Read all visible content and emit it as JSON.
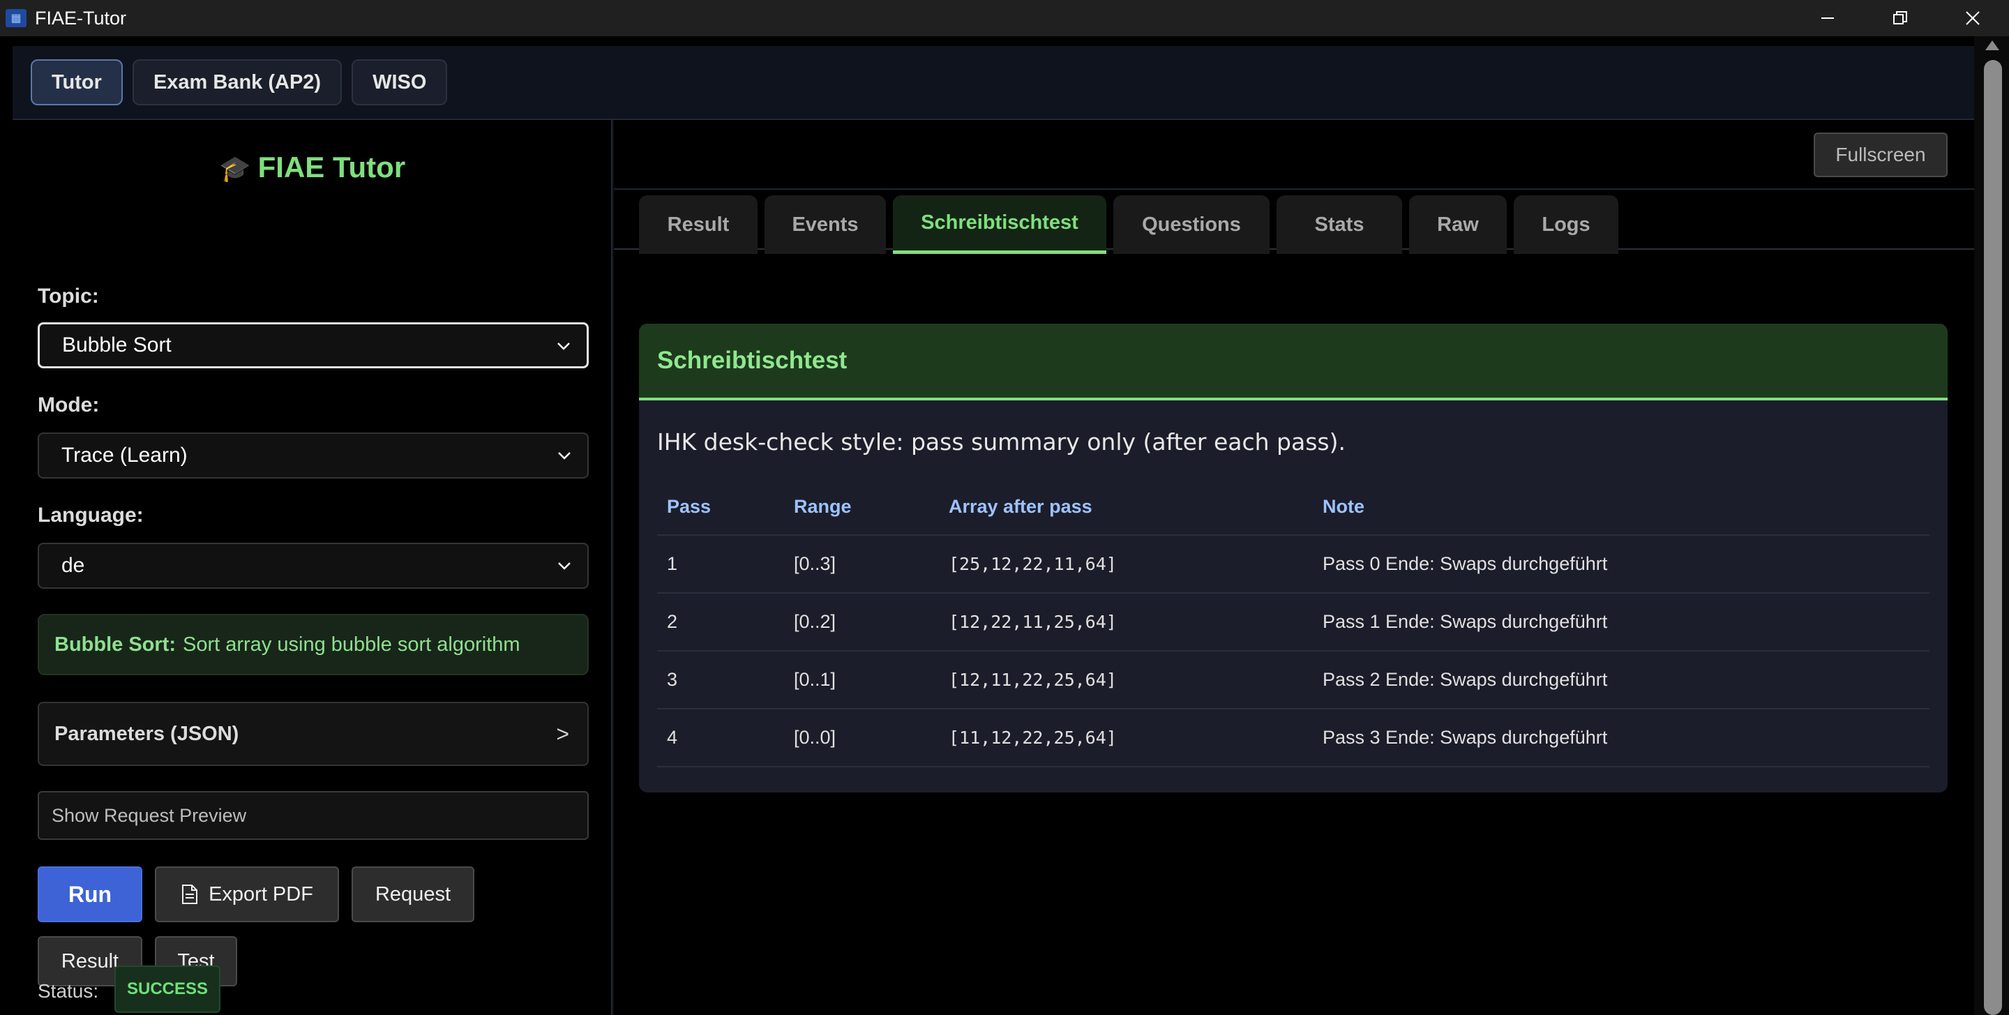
{
  "window": {
    "title": "FIAE-Tutor",
    "app_icon": "app-icon"
  },
  "nav": {
    "tabs": [
      "Tutor",
      "Exam Bank (AP2)",
      "WISO"
    ],
    "active": "Tutor"
  },
  "sidebar": {
    "brand": "FIAE Tutor",
    "brand_icon": "🎓",
    "topic_label": "Topic:",
    "topic_value": "Bubble Sort",
    "mode_label": "Mode:",
    "mode_value": "Trace (Learn)",
    "language_label": "Language:",
    "language_value": "de",
    "info_title": "Bubble Sort:",
    "info_text": "Sort array using bubble sort algorithm",
    "params_label": "Parameters (JSON)",
    "params_arrow": ">",
    "preview_label": "Show Request Preview",
    "buttons": {
      "run": "Run",
      "export_pdf": "Export PDF",
      "request": "Request",
      "result": "Result",
      "test": "Test"
    },
    "status_label": "Status:",
    "status_value": "SUCCESS"
  },
  "main": {
    "fullscreen_label": "Fullscreen",
    "tabs": [
      "Result",
      "Events",
      "Schreibtischtest",
      "Questions",
      "Stats",
      "Raw",
      "Logs"
    ],
    "active_tab": "Schreibtischtest",
    "card": {
      "title": "Schreibtischtest",
      "description": "IHK desk-check style: pass summary only (after each pass).",
      "columns": [
        "Pass",
        "Range",
        "Array after pass",
        "Note"
      ],
      "rows": [
        [
          "1",
          "[0..3]",
          "[25,12,22,11,64]",
          "Pass 0 Ende: Swaps durchgeführt"
        ],
        [
          "2",
          "[0..2]",
          "[12,22,11,25,64]",
          "Pass 1 Ende: Swaps durchgeführt"
        ],
        [
          "3",
          "[0..1]",
          "[12,11,22,25,64]",
          "Pass 2 Ende: Swaps durchgeführt"
        ],
        [
          "4",
          "[0..0]",
          "[11,12,22,25,64]",
          "Pass 3 Ende: Swaps durchgeführt"
        ]
      ]
    }
  },
  "colors": {
    "accent_green": "#7ee07e",
    "run_blue": "#3d63d6",
    "header_blue": "#9cc3ff"
  }
}
